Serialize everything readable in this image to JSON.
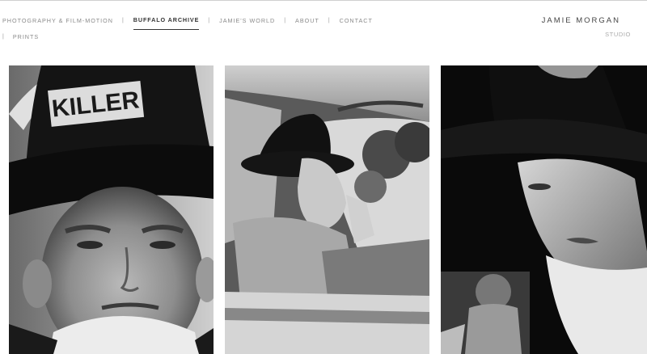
{
  "nav": {
    "items": [
      {
        "label": "PHOTOGRAPHY & FILM-MOTION",
        "active": false
      },
      {
        "label": "BUFFALO ARCHIVE",
        "active": true
      },
      {
        "label": "JAMIE'S WORLD",
        "active": false
      },
      {
        "label": "ABOUT",
        "active": false
      },
      {
        "label": "CONTACT",
        "active": false
      },
      {
        "label": "PRINTS",
        "active": false
      }
    ],
    "separator": "|"
  },
  "brand": {
    "name": "JAMIE MORGAN",
    "subtitle": "STUDIO"
  },
  "gallery": {
    "photos": [
      {
        "hat_text": "KILLER"
      },
      {},
      {}
    ]
  },
  "colors": {
    "background": "#ffffff",
    "nav_text": "#8a8a8a",
    "nav_active": "#333333",
    "brand_text": "#444444"
  }
}
